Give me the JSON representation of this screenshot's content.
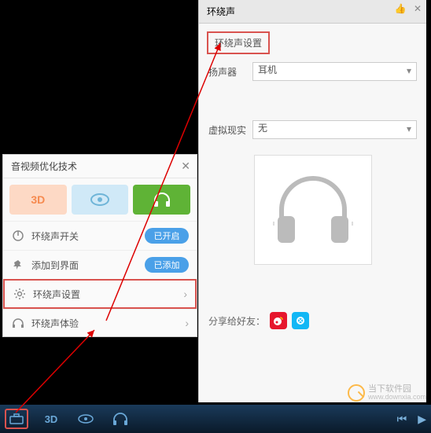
{
  "videoPanel": {
    "title": "音视频优化技术",
    "modes": {
      "threeD": "3D",
      "eye": "eye",
      "headphones": "headphones"
    },
    "rows": {
      "surroundSwitch": {
        "label": "环绕声开关",
        "toggle": "已开启"
      },
      "addToUI": {
        "label": "添加到界面",
        "toggle": "已添加"
      },
      "surroundSettings": {
        "label": "环绕声设置"
      },
      "surroundExperience": {
        "label": "环绕声体验"
      }
    }
  },
  "rightPanel": {
    "title": "环绕声",
    "sectionLabel": "环绕声设置",
    "speaker": {
      "label": "扬声器",
      "value": "耳机"
    },
    "vr": {
      "label": "虚拟现实",
      "value": "无"
    },
    "shareLabel": "分享给好友："
  },
  "bottomBar": {
    "threeD": "3D"
  },
  "watermark": {
    "name": "当下软件园",
    "url": "www.downxia.com"
  }
}
